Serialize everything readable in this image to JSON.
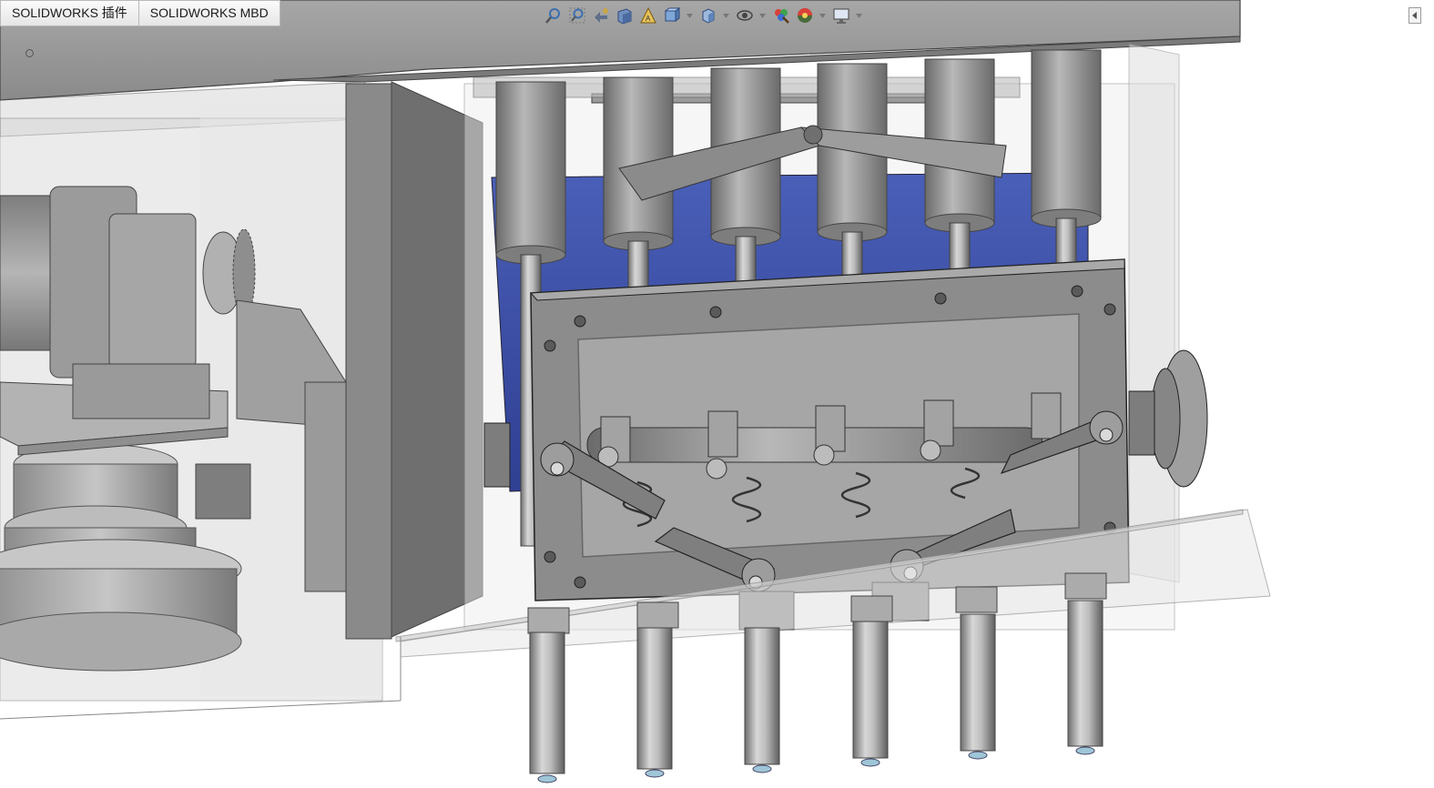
{
  "command_manager": {
    "tabs": [
      {
        "label": "SOLIDWORKS 插件"
      },
      {
        "label": "SOLIDWORKS MBD"
      }
    ]
  },
  "view_toolbar": {
    "buttons": [
      {
        "icon": "zoom-to-fit-icon"
      },
      {
        "icon": "zoom-to-area-icon"
      },
      {
        "icon": "previous-view-icon"
      },
      {
        "icon": "section-view-icon"
      },
      {
        "icon": "dynamic-annotation-views-icon"
      },
      {
        "icon": "view-orientation-icon"
      },
      {
        "icon": "display-style-icon"
      },
      {
        "icon": "hide-show-items-icon"
      },
      {
        "icon": "edit-appearance-icon"
      },
      {
        "icon": "apply-scene-icon"
      },
      {
        "icon": "view-settings-icon"
      }
    ]
  },
  "graphics": {
    "model": "filling-machine-assembly",
    "accent": "#3b4fa8",
    "metal": "#8e8e8e"
  }
}
